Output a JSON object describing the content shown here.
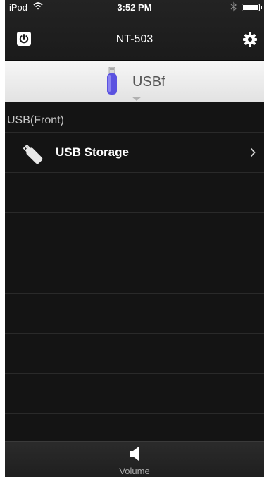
{
  "status_bar": {
    "carrier": "iPod",
    "time": "3:52 PM"
  },
  "nav": {
    "title": "NT-503",
    "left_icon": "power-icon",
    "right_icon": "gear-icon"
  },
  "source": {
    "label": "USBf",
    "icon": "usb-stick-icon",
    "icon_color": "#5b52e0"
  },
  "list": {
    "section_header": "USB(Front)",
    "items": [
      {
        "label": "USB Storage",
        "icon": "usb-drive-icon",
        "has_chevron": true
      }
    ]
  },
  "bottom_bar": {
    "volume_label": "Volume",
    "icon": "speaker-icon"
  }
}
